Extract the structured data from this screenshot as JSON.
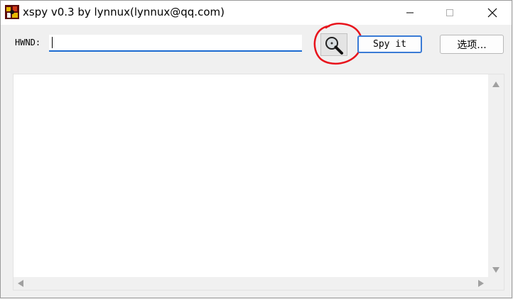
{
  "window": {
    "title": "xspy v0.3 by lynnux(lynnux@qq.com)",
    "accent_color": "#1c6bd1",
    "highlight_annotation_color": "#e8141c"
  },
  "icons": {
    "app": "xspy-app-icon",
    "minimize": "minimize-icon",
    "maximize": "maximize-icon",
    "close": "close-icon",
    "finder": "magnifier-finder-icon"
  },
  "toolbar": {
    "hwnd_label": "HWND:",
    "hwnd_value": "",
    "spy_button": "Spy it",
    "options_button": "选项..."
  },
  "output": {
    "text": ""
  }
}
